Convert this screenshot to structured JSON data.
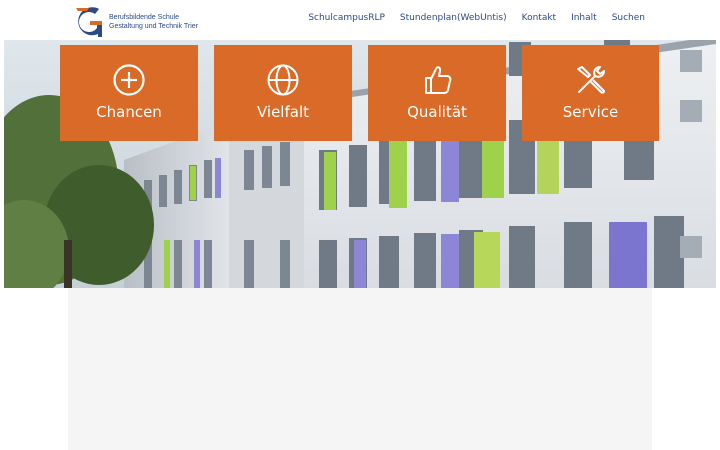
{
  "header": {
    "logo": {
      "line1": "Berufsbildende Schule",
      "line2": "Gestaltung und Technik Trier",
      "logo_icon": "bbs-g-logo-icon"
    },
    "nav": [
      {
        "label": "SchulcampusRLP"
      },
      {
        "label": "Stundenplan(WebUntis)"
      },
      {
        "label": "Kontakt"
      },
      {
        "label": "Inhalt"
      },
      {
        "label": "Suchen"
      }
    ]
  },
  "tiles": [
    {
      "label": "Chancen",
      "icon": "plus-circle-icon"
    },
    {
      "label": "Vielfalt",
      "icon": "globe-icon"
    },
    {
      "label": "Qualität",
      "icon": "thumbs-up-icon"
    },
    {
      "label": "Service",
      "icon": "tools-icon"
    }
  ],
  "colors": {
    "accent": "#d96a27",
    "brand_blue": "#2b4a86",
    "content_bg": "#f5f5f5"
  }
}
